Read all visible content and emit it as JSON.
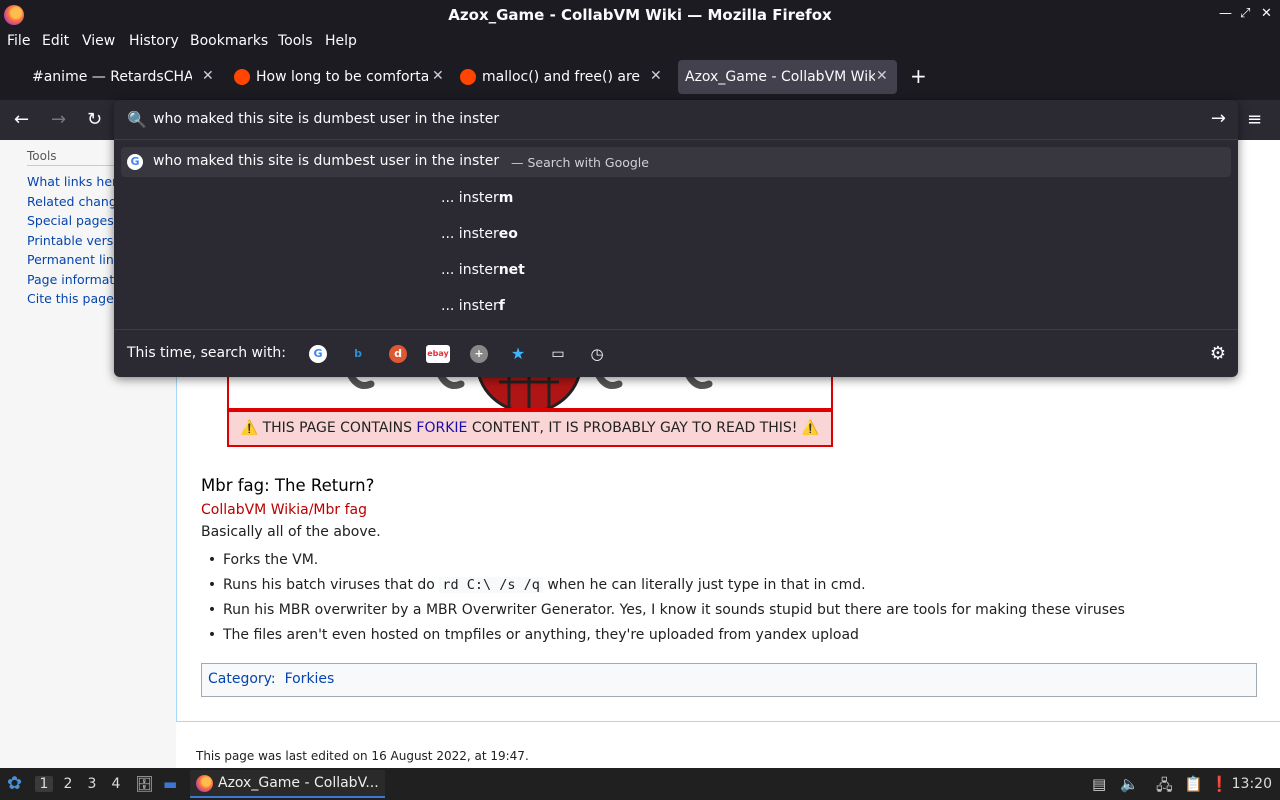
{
  "window": {
    "title": "Azox_Game - CollabVM Wiki — Mozilla Firefox"
  },
  "menu": [
    "File",
    "Edit",
    "View",
    "History",
    "Bookmarks",
    "Tools",
    "Help"
  ],
  "tabs": [
    {
      "label": "#anime — RetardsCHAT"
    },
    {
      "label": "How long to be comforta"
    },
    {
      "label": "malloc() and free() are a"
    },
    {
      "label": "Azox_Game - CollabVM Wiki"
    }
  ],
  "urlbar": {
    "value": "who maked this site is dumbest user in the inster",
    "main_suggestion": "who maked this site is dumbest user in the inster",
    "main_suggestion_desc": "— Search with Google",
    "suggestions": [
      {
        "prefix": "... inster",
        "completion": "m"
      },
      {
        "prefix": "... inster",
        "completion": "eo"
      },
      {
        "prefix": "... inster",
        "completion": "net"
      },
      {
        "prefix": "... inster",
        "completion": "f"
      }
    ],
    "oneoff_label": "This time, search with:",
    "engines": [
      "google-icon",
      "bing-icon",
      "duckduckgo-icon",
      "ebay-icon",
      "add-engine-icon",
      "bookmarks-icon",
      "tabs-icon",
      "history-icon"
    ]
  },
  "sidebar": {
    "heading": "Tools",
    "links": [
      "What links here",
      "Related changes",
      "Special pages",
      "Printable version",
      "Permanent link",
      "Page information",
      "Cite this page"
    ]
  },
  "article": {
    "warning_pre": "THIS PAGE CONTAINS",
    "warning_link": "FORKIE",
    "warning_post": "CONTENT, IT IS PROBABLY GAY TO READ THIS!",
    "heading": "Mbr fag: The Return?",
    "sublink": "CollabVM Wikia/Mbr fag",
    "intro": "Basically all of the above.",
    "bullets": [
      {
        "text": "Forks the VM."
      },
      {
        "pre": "Runs his batch viruses that do",
        "code": "rd C:\\ /s /q",
        "post": "when he can literally just type in that in cmd."
      },
      {
        "text": "Run his MBR overwriter by a MBR Overwriter Generator. Yes, I know it sounds stupid but there are tools for making these viruses"
      },
      {
        "text": "The files aren't even hosted on tmpfiles or anything, they're uploaded from yandex upload"
      }
    ],
    "category_label": "Category:",
    "category": "Forkies",
    "footer": "This page was last edited on 16 August 2022, at 19:47."
  },
  "taskbar": {
    "workspaces": [
      "1",
      "2",
      "3",
      "4"
    ],
    "task_label": "Azox_Game - CollabV...",
    "clock": "13:20"
  }
}
